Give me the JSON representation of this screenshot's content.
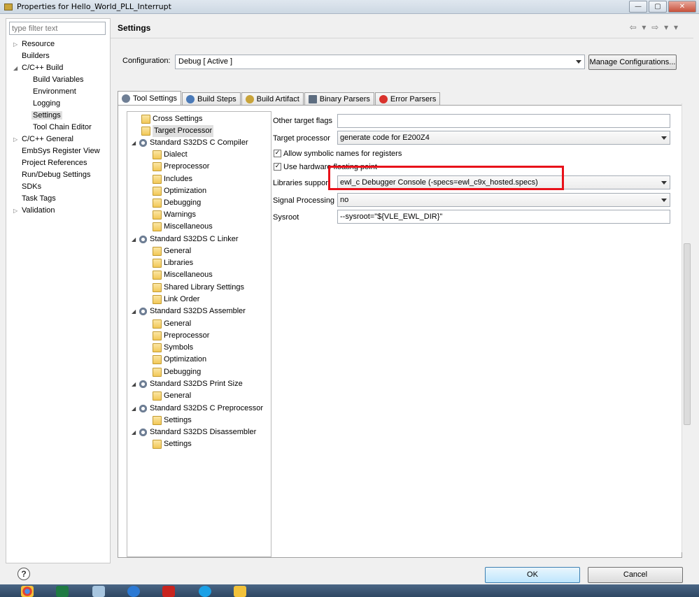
{
  "window": {
    "title": "Properties for Hello_World_PLL_Interrupt",
    "minimize_glyph": "—",
    "maximize_glyph": "▢",
    "close_glyph": "✕"
  },
  "filter": {
    "placeholder": "type filter text"
  },
  "nav": {
    "items": [
      {
        "label": "Resource",
        "arrow": "▷"
      },
      {
        "label": "Builders",
        "arrow": ""
      },
      {
        "label": "C/C++ Build",
        "arrow": "◢"
      },
      {
        "label": "Build Variables",
        "arrow": ""
      },
      {
        "label": "Environment",
        "arrow": ""
      },
      {
        "label": "Logging",
        "arrow": ""
      },
      {
        "label": "Settings",
        "arrow": ""
      },
      {
        "label": "Tool Chain Editor",
        "arrow": ""
      },
      {
        "label": "C/C++ General",
        "arrow": "▷"
      },
      {
        "label": "EmbSys Register View",
        "arrow": ""
      },
      {
        "label": "Project References",
        "arrow": ""
      },
      {
        "label": "Run/Debug Settings",
        "arrow": ""
      },
      {
        "label": "SDKs",
        "arrow": ""
      },
      {
        "label": "Task Tags",
        "arrow": ""
      },
      {
        "label": "Validation",
        "arrow": "▷"
      }
    ]
  },
  "header": {
    "title": "Settings",
    "nav_glyphs": "⇦ ▾ ⇨ ▾ ▾"
  },
  "configuration": {
    "label": "Configuration:",
    "value": "Debug  [ Active ]",
    "manage_button": "Manage Configurations..."
  },
  "tabs": [
    {
      "label": "Tool Settings",
      "icon_color": "#6f7f95"
    },
    {
      "label": "Build Steps",
      "icon_color": "#4a7ab8"
    },
    {
      "label": "Build Artifact",
      "icon_color": "#c9a43a"
    },
    {
      "label": "Binary Parsers",
      "icon_color": "#5d6d80"
    },
    {
      "label": "Error Parsers",
      "icon_color": "#d9322c"
    }
  ],
  "tooltree": {
    "arrow_expanded": "◢",
    "items": [
      {
        "label": "Cross Settings"
      },
      {
        "label": "Target Processor"
      },
      {
        "label": "Standard S32DS C Compiler"
      },
      {
        "label": "Dialect"
      },
      {
        "label": "Preprocessor"
      },
      {
        "label": "Includes"
      },
      {
        "label": "Optimization"
      },
      {
        "label": "Debugging"
      },
      {
        "label": "Warnings"
      },
      {
        "label": "Miscellaneous"
      },
      {
        "label": "Standard S32DS C Linker"
      },
      {
        "label": "General"
      },
      {
        "label": "Libraries"
      },
      {
        "label": "Miscellaneous"
      },
      {
        "label": "Shared Library Settings"
      },
      {
        "label": "Link Order"
      },
      {
        "label": "Standard S32DS Assembler"
      },
      {
        "label": "General"
      },
      {
        "label": "Preprocessor"
      },
      {
        "label": "Symbols"
      },
      {
        "label": "Optimization"
      },
      {
        "label": "Debugging"
      },
      {
        "label": "Standard S32DS Print Size"
      },
      {
        "label": "General"
      },
      {
        "label": "Standard S32DS C Preprocessor"
      },
      {
        "label": "Settings"
      },
      {
        "label": "Standard S32DS Disassembler"
      },
      {
        "label": "Settings"
      }
    ]
  },
  "form": {
    "other_flags_label": "Other target flags",
    "other_flags_value": "",
    "target_processor_label": "Target processor",
    "target_processor_value": "generate code for E200Z4",
    "allow_symbolic_label": "Allow symbolic names for registers",
    "use_hw_float_label": "Use hardware floating point",
    "check_glyph": "✓",
    "libraries_label": "Libraries support",
    "libraries_value": "ewl_c Debugger Console (-specs=ewl_c9x_hosted.specs)",
    "signal_label": "Signal Processing",
    "signal_value": "no",
    "sysroot_label": "Sysroot",
    "sysroot_value": "--sysroot=\"${VLE_EWL_DIR}\""
  },
  "buttons": {
    "ok": "OK",
    "cancel": "Cancel",
    "help": "?"
  },
  "colors": {
    "highlight": "#e8111a"
  }
}
